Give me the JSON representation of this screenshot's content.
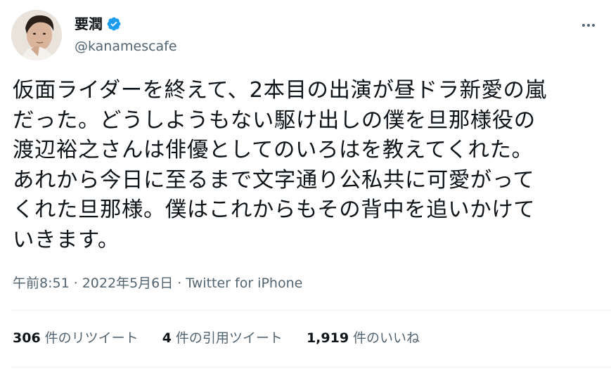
{
  "author": {
    "display_name": "要潤",
    "handle": "@kanamescafe",
    "verified": true,
    "verified_color": "#1d9bf0"
  },
  "tweet": {
    "text": "仮面ライダーを終えて、2本目の出演が昼ドラ新愛の嵐\nだった。どうしようもない駆け出しの僕を旦那様役の\n渡辺裕之さんは俳優としてのいろはを教えてくれた。\nあれから今日に至るまで文字通り公私共に可愛がって\nくれた旦那様。僕はこれからもその背中を追いかけて\nいきます。"
  },
  "meta": {
    "time": "午前8:51",
    "separator": "·",
    "date": "2022年5月6日",
    "source": "Twitter for iPhone"
  },
  "stats": {
    "retweets": {
      "count": "306",
      "label": "件のリツイート"
    },
    "quotes": {
      "count": "4",
      "label": "件の引用ツイート"
    },
    "likes": {
      "count": "1,919",
      "label": "件のいいね"
    }
  },
  "icons": {
    "more": "more-horizontal-icon",
    "verified": "verified-badge-icon"
  }
}
